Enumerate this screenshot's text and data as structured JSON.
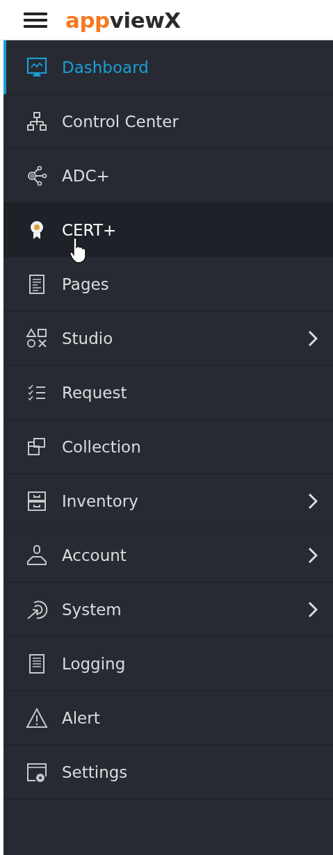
{
  "header": {
    "logo": {
      "accent": "app",
      "rest": "viewX"
    }
  },
  "sidebar": {
    "items": [
      {
        "label": "Dashboard",
        "selected": true,
        "hovered": false,
        "submenu": false
      },
      {
        "label": "Control Center",
        "selected": false,
        "hovered": false,
        "submenu": false
      },
      {
        "label": "ADC+",
        "selected": false,
        "hovered": false,
        "submenu": false
      },
      {
        "label": "CERT+",
        "selected": false,
        "hovered": true,
        "submenu": false
      },
      {
        "label": "Pages",
        "selected": false,
        "hovered": false,
        "submenu": false
      },
      {
        "label": "Studio",
        "selected": false,
        "hovered": false,
        "submenu": true
      },
      {
        "label": "Request",
        "selected": false,
        "hovered": false,
        "submenu": false
      },
      {
        "label": "Collection",
        "selected": false,
        "hovered": false,
        "submenu": false
      },
      {
        "label": "Inventory",
        "selected": false,
        "hovered": false,
        "submenu": true
      },
      {
        "label": "Account",
        "selected": false,
        "hovered": false,
        "submenu": true
      },
      {
        "label": "System",
        "selected": false,
        "hovered": false,
        "submenu": true
      },
      {
        "label": "Logging",
        "selected": false,
        "hovered": false,
        "submenu": false
      },
      {
        "label": "Alert",
        "selected": false,
        "hovered": false,
        "submenu": false
      },
      {
        "label": "Settings",
        "selected": false,
        "hovered": false,
        "submenu": false
      }
    ]
  }
}
